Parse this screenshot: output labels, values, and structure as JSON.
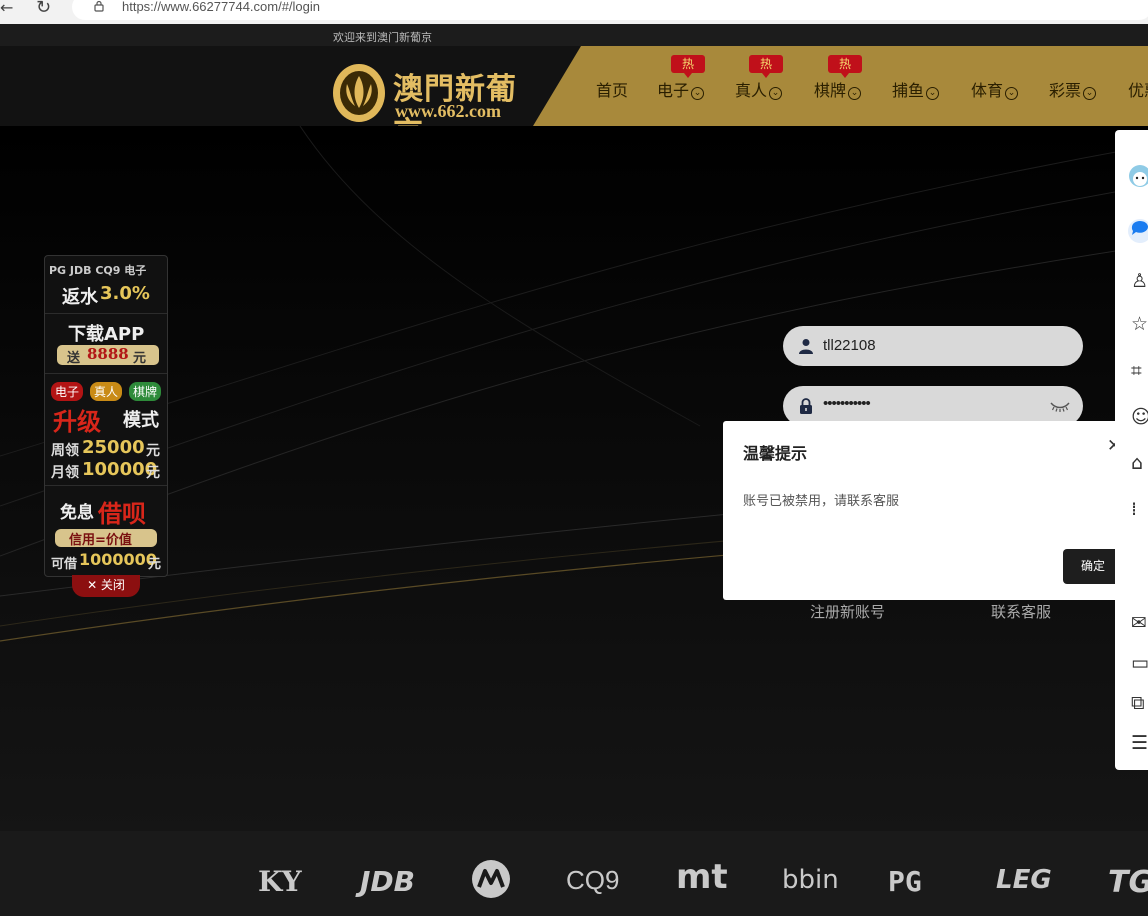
{
  "browser": {
    "url": "https://www.66277744.com/#/login"
  },
  "topline": {
    "welcome": "欢迎来到澳门新葡京"
  },
  "logo": {
    "brand": "澳門新葡京",
    "site": "www.662.com"
  },
  "nav": {
    "hot_label": "热",
    "items": [
      {
        "label": "首页"
      },
      {
        "label": "电子"
      },
      {
        "label": "真人"
      },
      {
        "label": "棋牌"
      },
      {
        "label": "捕鱼"
      },
      {
        "label": "体育"
      },
      {
        "label": "彩票"
      },
      {
        "label": "优惠"
      }
    ]
  },
  "promo": {
    "providers": "PG JDB CQ9 电子",
    "rebate_prefix": "返水",
    "rebate_value": "3.0%",
    "download": "下载APP",
    "send_prefix": "送",
    "send_amount": "8888",
    "send_suffix": "元",
    "tag_slots": "电子",
    "tag_live": "真人",
    "tag_cards": "棋牌",
    "upgrade_a": "升级",
    "upgrade_b": "模式",
    "weekly_prefix": "周领",
    "weekly_amount": "25000",
    "monthly_prefix": "月领",
    "monthly_amount": "100000",
    "currency": "元",
    "loan_a": "免息",
    "loan_b": "借呗",
    "credit": "信用=价值",
    "borrow_prefix": "可借",
    "borrow_amount": "1000000",
    "close": "✕ 关闭"
  },
  "login": {
    "username": "tll22108",
    "password_mask": "•••••••••••",
    "register": "注册新账号",
    "support": "联系客服"
  },
  "dialog": {
    "title": "温馨提示",
    "close": "✕",
    "message": "账号已被禁用，请联系客服",
    "ok": "确定"
  },
  "footer": {
    "providers": [
      "KY",
      "JDB",
      "M",
      "CQ9",
      "mt",
      "bbin",
      "PG",
      "LEG",
      "TG"
    ]
  },
  "colors": {
    "gold": "#a8893b",
    "hot_red": "#c0101a",
    "logo_gold": "#e3bd63"
  }
}
